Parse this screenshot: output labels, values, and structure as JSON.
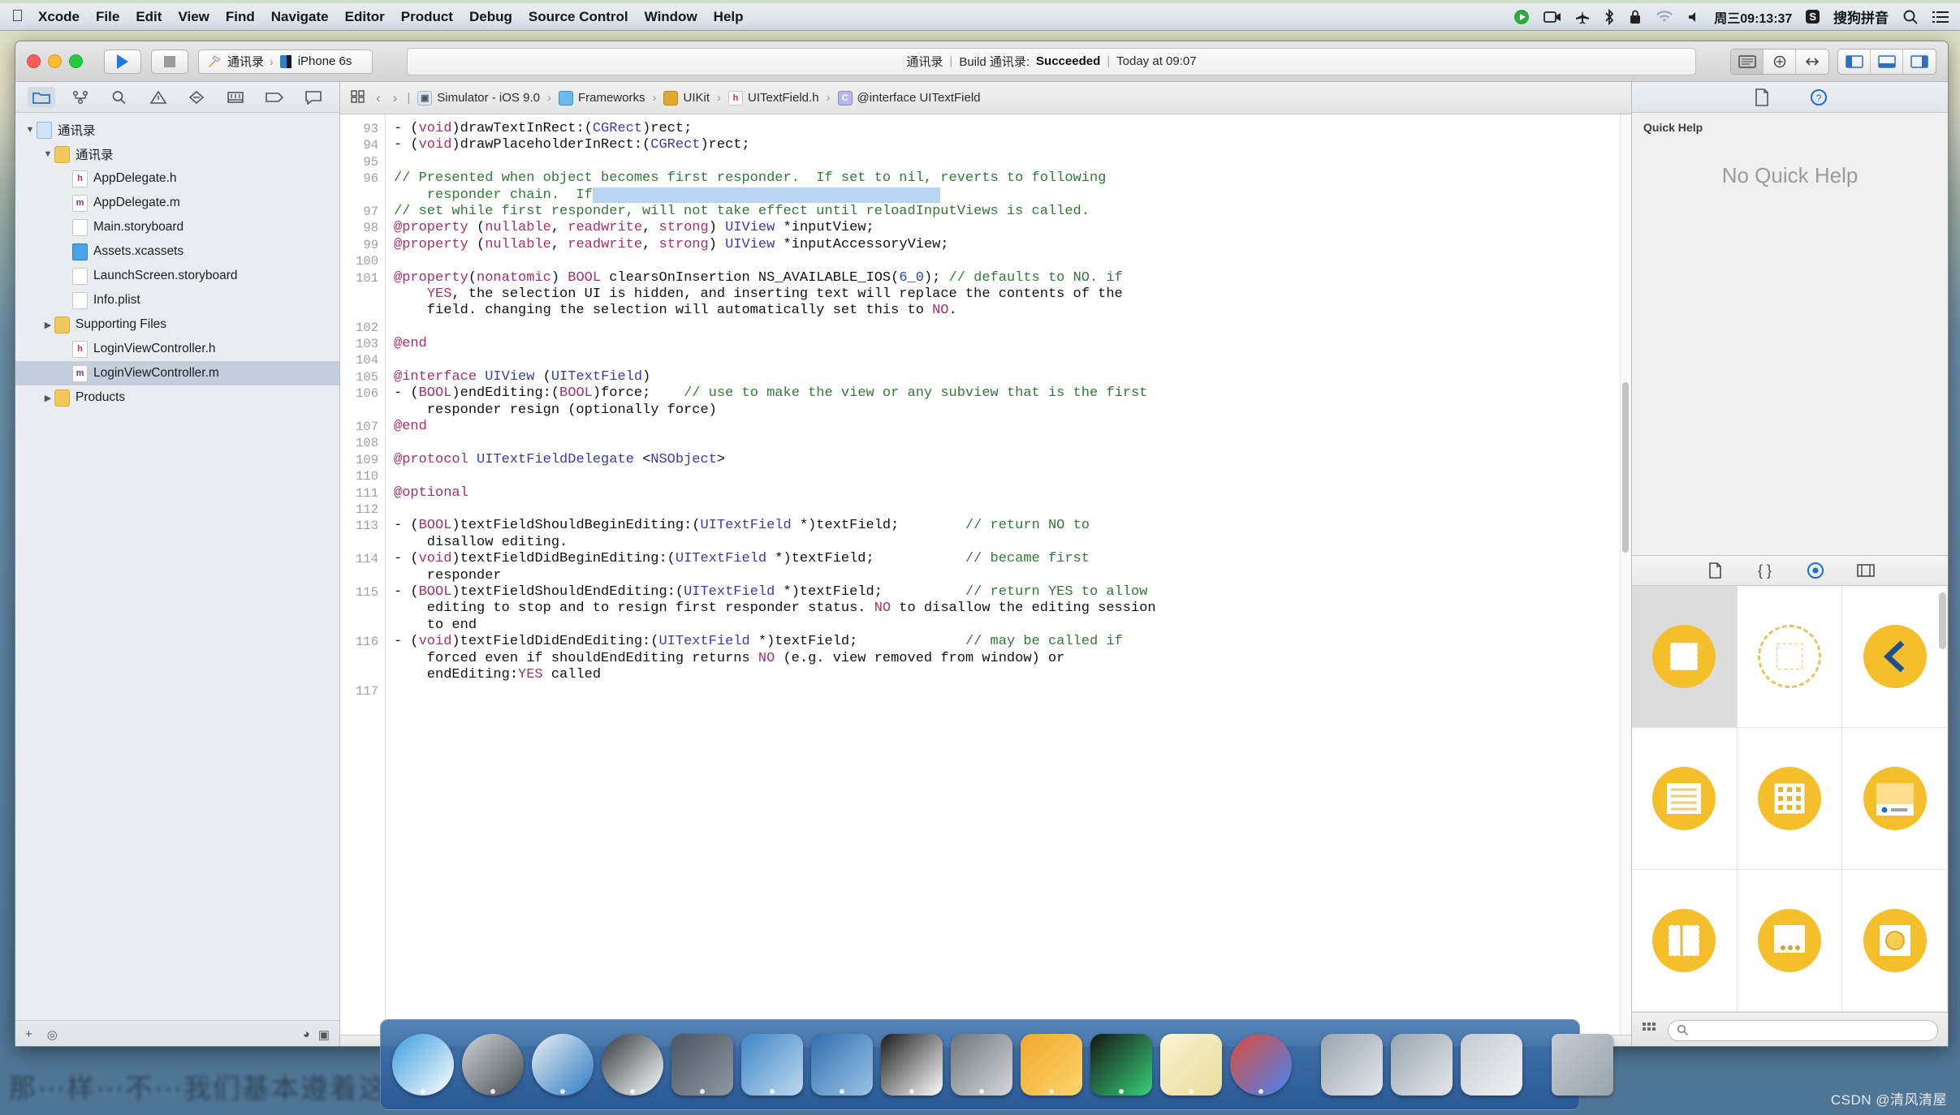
{
  "menubar": {
    "apple_icon": "apple-icon",
    "items": [
      "Xcode",
      "File",
      "Edit",
      "View",
      "Find",
      "Navigate",
      "Editor",
      "Product",
      "Debug",
      "Source Control",
      "Window",
      "Help"
    ],
    "status_icons": [
      "screen-share-icon",
      "screen-record-icon",
      "airplane-icon",
      "bluetooth-icon",
      "lock-icon",
      "wifi-icon",
      "volume-icon"
    ],
    "clock": "周三09:13:37",
    "input_method_badge": "S",
    "input_method": "搜狗拼音",
    "search_icon": "search-icon",
    "control_center_icon": "list-icon"
  },
  "toolbar": {
    "run_icon": "play-icon",
    "stop_icon": "stop-icon",
    "scheme_project": "通讯录",
    "scheme_separator": "›",
    "scheme_device": "iPhone 6s",
    "status_project": "通讯录",
    "status_build_label": "Build 通讯录:",
    "status_result": "Succeeded",
    "status_time": "Today at 09:07",
    "editor_icons": [
      "standard-editor-icon",
      "assistant-editor-icon",
      "version-editor-icon"
    ],
    "view_icons": [
      "navigator-toggle-icon",
      "debug-area-toggle-icon",
      "utilities-toggle-icon"
    ]
  },
  "navigator": {
    "tabs": [
      "folder-icon",
      "source-control-icon",
      "search-icon",
      "warning-icon",
      "breakpoint-icon",
      "test-icon",
      "report-icon",
      "debug-icon"
    ],
    "tree": [
      {
        "label": "通讯录",
        "icon": "project-icon",
        "depth": 0,
        "twisty": "▼",
        "selected": false
      },
      {
        "label": "通讯录",
        "icon": "folder-icon",
        "depth": 1,
        "twisty": "▼",
        "selected": false
      },
      {
        "label": "AppDelegate.h",
        "icon": "header-file-icon",
        "depth": 2,
        "twisty": "",
        "selected": false
      },
      {
        "label": "AppDelegate.m",
        "icon": "objc-file-icon",
        "depth": 2,
        "twisty": "",
        "selected": false
      },
      {
        "label": "Main.storyboard",
        "icon": "storyboard-icon",
        "depth": 2,
        "twisty": "",
        "selected": false
      },
      {
        "label": "Assets.xcassets",
        "icon": "assets-icon",
        "depth": 2,
        "twisty": "",
        "selected": false
      },
      {
        "label": "LaunchScreen.storyboard",
        "icon": "storyboard-icon",
        "depth": 2,
        "twisty": "",
        "selected": false
      },
      {
        "label": "Info.plist",
        "icon": "plist-icon",
        "depth": 2,
        "twisty": "",
        "selected": false
      },
      {
        "label": "Supporting Files",
        "icon": "folder-icon",
        "depth": 1,
        "twisty": "▶",
        "selected": false
      },
      {
        "label": "LoginViewController.h",
        "icon": "header-file-icon",
        "depth": 2,
        "twisty": "",
        "selected": false
      },
      {
        "label": "LoginViewController.m",
        "icon": "objc-file-icon",
        "depth": 2,
        "twisty": "",
        "selected": true
      },
      {
        "label": "Products",
        "icon": "folder-icon",
        "depth": 1,
        "twisty": "▶",
        "selected": false
      }
    ],
    "footer": {
      "add_icon": "plus-icon",
      "filter_icon": "filter-icon",
      "recent_icon": "clock-icon",
      "unsaved_icon": "unsaved-icon"
    }
  },
  "jumpbar": {
    "related_icon": "related-items-icon",
    "back_icon": "chevron-left-icon",
    "forward_icon": "chevron-right-icon",
    "crumbs": [
      {
        "label": "Simulator - iOS 9.0",
        "icon": "simulator-icon"
      },
      {
        "label": "Frameworks",
        "icon": "folder-icon"
      },
      {
        "label": "UIKit",
        "icon": "framework-icon"
      },
      {
        "label": "UITextField.h",
        "icon": "header-file-icon"
      },
      {
        "label": "@interface UITextField",
        "icon": "interface-icon"
      }
    ]
  },
  "editor": {
    "first_line": 93,
    "lines": [
      {
        "n": 93,
        "text": "- (void)drawTextInRect:(CGRect)rect;"
      },
      {
        "n": 94,
        "text": "- (void)drawPlaceholderInRect:(CGRect)rect;"
      },
      {
        "n": 95,
        "text": ""
      },
      {
        "n": 96,
        "text": "// Presented when object becomes first responder.  If set to nil, reverts to following"
      },
      {
        "n": "",
        "text": "    responder chain.  If"
      },
      {
        "n": 97,
        "text": "// set while first responder, will not take effect until reloadInputViews is called."
      },
      {
        "n": 98,
        "text": "@property (nullable, readwrite, strong) UIView *inputView;"
      },
      {
        "n": 99,
        "text": "@property (nullable, readwrite, strong) UIView *inputAccessoryView;"
      },
      {
        "n": 100,
        "text": ""
      },
      {
        "n": 101,
        "text": "@property(nonatomic) BOOL clearsOnInsertion NS_AVAILABLE_IOS(6_0); // defaults to NO. if"
      },
      {
        "n": "",
        "text": "    YES, the selection UI is hidden, and inserting text will replace the contents of the"
      },
      {
        "n": "",
        "text": "    field. changing the selection will automatically set this to NO."
      },
      {
        "n": 102,
        "text": ""
      },
      {
        "n": 103,
        "text": "@end"
      },
      {
        "n": 104,
        "text": ""
      },
      {
        "n": 105,
        "text": "@interface UIView (UITextField)"
      },
      {
        "n": 106,
        "text": "- (BOOL)endEditing:(BOOL)force;    // use to make the view or any subview that is the first"
      },
      {
        "n": "",
        "text": "    responder resign (optionally force)"
      },
      {
        "n": 107,
        "text": "@end"
      },
      {
        "n": 108,
        "text": ""
      },
      {
        "n": 109,
        "text": "@protocol UITextFieldDelegate <NSObject>"
      },
      {
        "n": 110,
        "text": ""
      },
      {
        "n": 111,
        "text": "@optional"
      },
      {
        "n": 112,
        "text": ""
      },
      {
        "n": 113,
        "text": "- (BOOL)textFieldShouldBeginEditing:(UITextField *)textField;        // return NO to"
      },
      {
        "n": "",
        "text": "    disallow editing."
      },
      {
        "n": 114,
        "text": "- (void)textFieldDidBeginEditing:(UITextField *)textField;           // became first"
      },
      {
        "n": "",
        "text": "    responder"
      },
      {
        "n": 115,
        "text": "- (BOOL)textFieldShouldEndEditing:(UITextField *)textField;          // return YES to allow"
      },
      {
        "n": "",
        "text": "    editing to stop and to resign first responder status. NO to disallow the editing session"
      },
      {
        "n": "",
        "text": "    to end"
      },
      {
        "n": 116,
        "text": "- (void)textFieldDidEndEditing:(UITextField *)textField;             // may be called if"
      },
      {
        "n": "",
        "text": "    forced even if shouldEndEditing returns NO (e.g. view removed from window) or"
      },
      {
        "n": "",
        "text": "    endEditing:YES called"
      },
      {
        "n": 117,
        "text": ""
      }
    ]
  },
  "utilities": {
    "tabs": [
      "file-inspector-icon",
      "quick-help-icon"
    ],
    "quick_help_title": "Quick Help",
    "quick_help_empty": "No Quick Help",
    "library_tabs": [
      "file-template-library-icon",
      "code-snippet-library-icon",
      "object-library-icon",
      "media-library-icon"
    ],
    "library_items": [
      {
        "name": "view-object",
        "selected": true
      },
      {
        "name": "view-controller-object",
        "selected": false
      },
      {
        "name": "navigation-controller-object",
        "selected": false
      },
      {
        "name": "table-view-controller-object",
        "selected": false
      },
      {
        "name": "collection-view-controller-object",
        "selected": false
      },
      {
        "name": "tab-bar-controller-object",
        "selected": false
      },
      {
        "name": "split-view-controller-object",
        "selected": false
      },
      {
        "name": "page-view-controller-object",
        "selected": false
      },
      {
        "name": "glkit-view-controller-object",
        "selected": false
      }
    ],
    "filter_icon": "grid-icon",
    "search_placeholder": ""
  },
  "dock": {
    "items": [
      {
        "name": "finder",
        "colors": [
          "#3b9ede",
          "#ffffff"
        ]
      },
      {
        "name": "launchpad",
        "colors": [
          "#cfd3d8",
          "#4a4f55"
        ]
      },
      {
        "name": "safari",
        "colors": [
          "#e9eef3",
          "#2e7cc4"
        ]
      },
      {
        "name": "mouse-app",
        "colors": [
          "#33383d",
          "#ffffff"
        ]
      },
      {
        "name": "quicktime",
        "colors": [
          "#4a5560",
          "#8e99a4"
        ]
      },
      {
        "name": "xcode",
        "colors": [
          "#3d86c6",
          "#bfd9ef"
        ]
      },
      {
        "name": "xcode-beta",
        "colors": [
          "#2f6fae",
          "#9cc4e6"
        ]
      },
      {
        "name": "terminal",
        "colors": [
          "#1c1c1c",
          "#ffffff"
        ]
      },
      {
        "name": "system-preferences",
        "colors": [
          "#6e7479",
          "#d5d9dc"
        ]
      },
      {
        "name": "sketch",
        "colors": [
          "#f2a82e",
          "#fbd56a"
        ]
      },
      {
        "name": "iterm",
        "colors": [
          "#151515",
          "#37d17a"
        ]
      },
      {
        "name": "notes",
        "colors": [
          "#fbf3cf",
          "#e8dca0"
        ]
      },
      {
        "name": "chrome",
        "colors": [
          "#e04b3a",
          "#4285f4"
        ]
      },
      {
        "name": "screenshot-1",
        "colors": [
          "#9aa5ae",
          "#e4e8ec"
        ]
      },
      {
        "name": "screenshot-2",
        "colors": [
          "#9aa5ae",
          "#e4e8ec"
        ]
      },
      {
        "name": "screenshot-3",
        "colors": [
          "#c6ccd2",
          "#f0f2f4"
        ]
      },
      {
        "name": "trash",
        "colors": [
          "#c6ccd2",
          "#9aa2ab"
        ]
      }
    ]
  },
  "desktop": {
    "blurred_text": "那⋯样⋯不⋯我们基本遵着这心以UITextFieldDelegate⋯有",
    "watermark": "CSDN @清风清屋"
  }
}
